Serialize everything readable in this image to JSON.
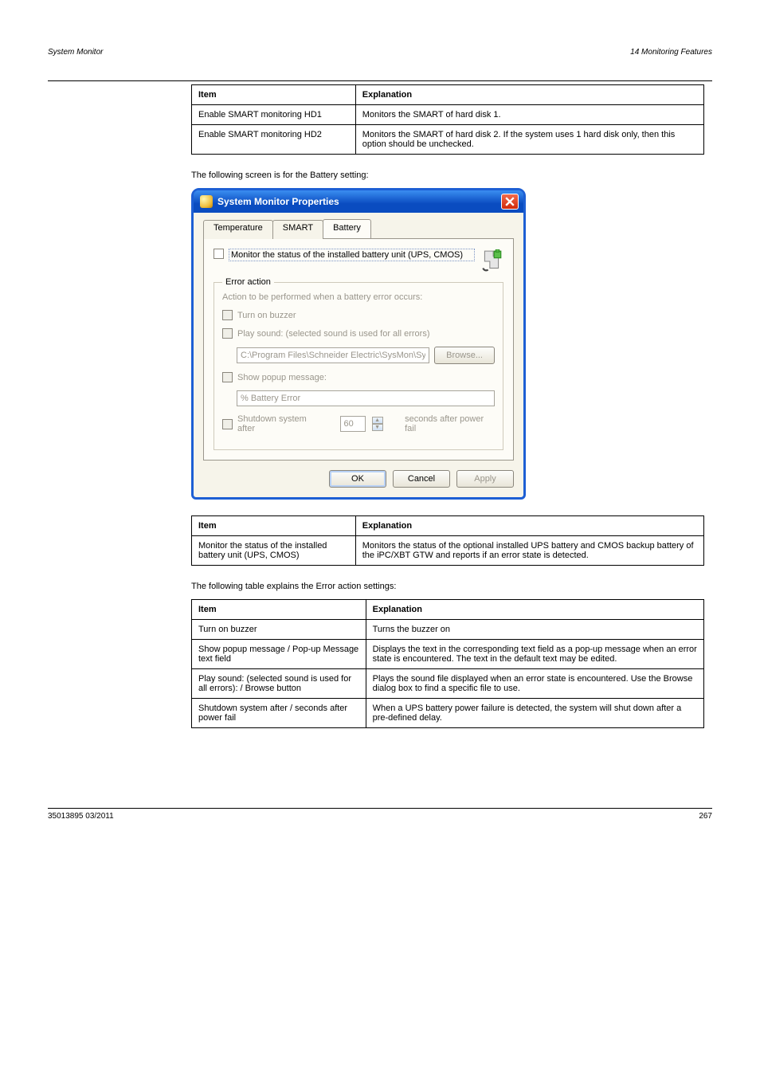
{
  "header": {
    "left": "System Monitor",
    "right": "14 Monitoring Features"
  },
  "table_smart": {
    "headers": [
      "Item",
      "Explanation"
    ],
    "rows": [
      [
        "Enable SMART monitoring HD1",
        "Monitors the SMART of hard disk 1."
      ],
      [
        "Enable SMART monitoring HD2",
        "Monitors the SMART of hard disk 2. If the system uses 1 hard disk only, then this option should be unchecked."
      ]
    ]
  },
  "para_battery": "The following screen is for the Battery setting:",
  "xp": {
    "title": "System Monitor Properties",
    "tabs": [
      "Temperature",
      "SMART",
      "Battery"
    ],
    "active_tab": 2,
    "monitor_label": "Monitor the status of the installed battery unit (UPS, CMOS)",
    "fieldset_legend": "Error action",
    "perform_label": "Action to be performed when a battery error occurs:",
    "turn_on_buzzer": "Turn on buzzer",
    "play_sound": "Play sound:  (selected sound is used for all errors)",
    "sound_path": "C:\\Program Files\\Schneider Electric\\SysMon\\SysMonAl",
    "browse": "Browse...",
    "show_popup": "Show popup message:",
    "popup_msg": "% Battery Error",
    "shutdown": "Shutdown system after",
    "shutdown_seconds": "60",
    "seconds_after": "seconds after power fail",
    "ok": "OK",
    "cancel": "Cancel",
    "apply": "Apply"
  },
  "table_battery_monitor": {
    "headers": [
      "Item",
      "Explanation"
    ],
    "rows": [
      [
        "Monitor the status of the installed battery unit (UPS, CMOS)",
        "Monitors the status of the optional installed UPS battery and CMOS backup battery of the iPC/XBT GTW and reports if an error state is detected."
      ]
    ]
  },
  "para_error": "The following table explains the Error action settings:",
  "table_error_action": {
    "headers": [
      "Item",
      "Explanation"
    ],
    "rows": [
      [
        "Turn on buzzer",
        "Turns the buzzer on"
      ],
      [
        "Show popup message / Pop-up Message text field",
        "Displays the text in the corresponding text field as a pop-up message when an error state is encountered. The text in the default text may be edited."
      ],
      [
        "Play sound: (selected sound is used for all errors): / Browse button",
        "Plays the sound file displayed when an error state is encountered. Use the Browse dialog box to find a specific file to use."
      ],
      [
        "Shutdown system after / seconds after power fail",
        "When a UPS battery power failure is detected, the system will shut down after a pre-defined delay."
      ]
    ]
  },
  "footer": {
    "left": "35013895 03/2011",
    "right": "267"
  }
}
